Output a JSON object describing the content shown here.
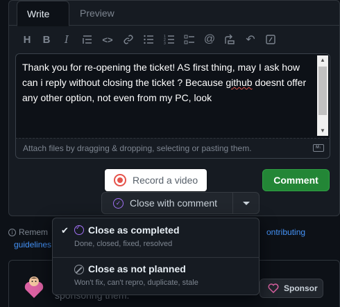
{
  "tabs": {
    "write": "Write",
    "preview": "Preview"
  },
  "toolbar": {
    "heading": "H",
    "bold": "B",
    "italic": "I",
    "quote": "❝",
    "code": "<>",
    "link": "🔗",
    "ul": "☰",
    "ol": "≡",
    "tasklist": "☑",
    "mention": "@",
    "reference": "⤴",
    "undo": "↶",
    "slash": "⧄"
  },
  "editor": {
    "text_before": "Thank you for re-opening the ticket! AS first thing, may I ask how can i reply without closing the ticket ? Because ",
    "misspelled_word": "github",
    "text_after": " doesnt offer any other option, not even from my PC, look",
    "attach_hint": "Attach files by dragging & dropping, selecting or pasting them.",
    "markdown_badge": "M↓"
  },
  "actions": {
    "record_video": "Record a video",
    "comment": "Comment",
    "close_with_comment": "Close with comment"
  },
  "reminder": {
    "prefix": "Remem",
    "link_part1": "ontributing",
    "link_part2": "guidelines"
  },
  "sponsor": {
    "text": "sponsoring them.",
    "button": "Sponsor"
  },
  "close_menu": {
    "items": [
      {
        "title": "Close as completed",
        "description": "Done, closed, fixed, resolved",
        "selected": true
      },
      {
        "title": "Close as not planned",
        "description": "Won't fix, can't repro, duplicate, stale",
        "selected": false
      }
    ]
  },
  "colors": {
    "accent_purple": "#a371f7",
    "primary_green": "#238636",
    "record_red": "#e5534b",
    "link_blue": "#4493f8",
    "sponsor_pink": "#db61a2"
  }
}
